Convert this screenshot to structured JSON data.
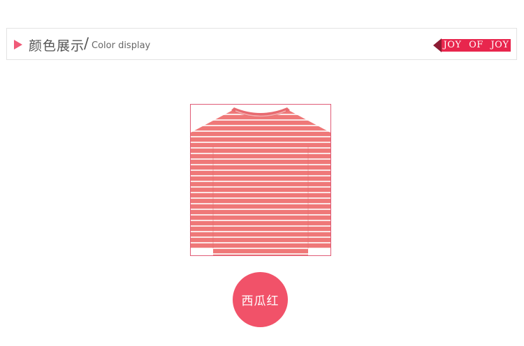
{
  "header": {
    "title_cn": "颜色展示",
    "separator": "/",
    "title_en": "Color display",
    "accent_color": "#f05a78"
  },
  "brand": {
    "logo_text": "JOY OF JOY",
    "badge_color": "#e8264d",
    "arrow_color": "#8c1c33"
  },
  "product": {
    "image_icon": "striped-sweater-image",
    "frame_color": "#e05b76",
    "garment_color": "#ef7878",
    "stripe_color": "#ffffff"
  },
  "color_swatch": {
    "label": "西瓜红",
    "color": "#f15269"
  }
}
